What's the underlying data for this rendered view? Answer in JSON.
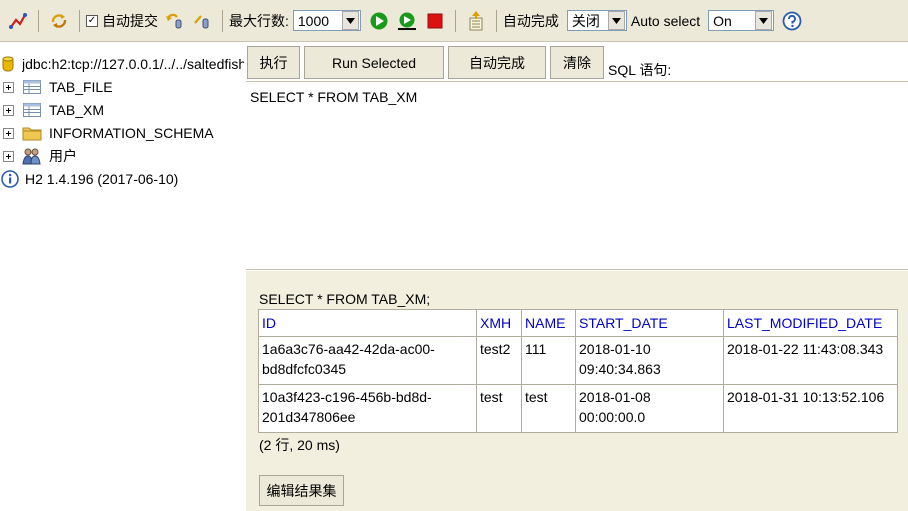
{
  "toolbar": {
    "autocommit_label": "自动提交",
    "autocommit_checked": "✓",
    "maxrows_label": "最大行数:",
    "maxrows_value": "1000",
    "autocomplete_label": "自动完成",
    "autocomplete_value": "关闭",
    "autoselect_label": "Auto select",
    "autoselect_value": "On"
  },
  "tree": {
    "connection": "jdbc:h2:tcp://127.0.0.1/../../saltedfish",
    "items": [
      {
        "label": "TAB_FILE",
        "icon": "table-icon"
      },
      {
        "label": "TAB_XM",
        "icon": "table-icon"
      },
      {
        "label": "INFORMATION_SCHEMA",
        "icon": "folder-icon"
      },
      {
        "label": "用户",
        "icon": "users-icon"
      }
    ],
    "version": "H2 1.4.196 (2017-06-10)"
  },
  "buttons": {
    "execute": "执行",
    "run_selected": "Run Selected",
    "autocomplete": "自动完成",
    "clear": "清除"
  },
  "sql": {
    "label": "SQL 语句:",
    "text": "SELECT * FROM TAB_XM"
  },
  "results": {
    "query": "SELECT * FROM TAB_XM;",
    "columns": [
      "ID",
      "XMH",
      "NAME",
      "START_DATE",
      "LAST_MODIFIED_DATE"
    ],
    "rows": [
      {
        "id1": "1a6a3c76-aa42-42da-ac00-",
        "id2": "bd8dfcfc0345",
        "xmh": "test2",
        "name": "111",
        "start1": "2018-01-10",
        "start2": "09:40:34.863",
        "last": "2018-01-22 11:43:08.343"
      },
      {
        "id1": "10a3f423-c196-456b-bd8d-",
        "id2": "201d347806ee",
        "xmh": "test",
        "name": "test",
        "start1": "2018-01-08",
        "start2": "00:00:00.0",
        "last": "2018-01-31 10:13:52.106"
      }
    ],
    "row_count": "(2 行, 20 ms)",
    "edit_label": "编辑结果集"
  },
  "colors": {
    "toolbar_bg": "#ece9d8",
    "results_bg": "#f2efdf",
    "header_text": "#0000cc",
    "run_green": "#1a9a1a",
    "stop_red": "#dd1111"
  }
}
